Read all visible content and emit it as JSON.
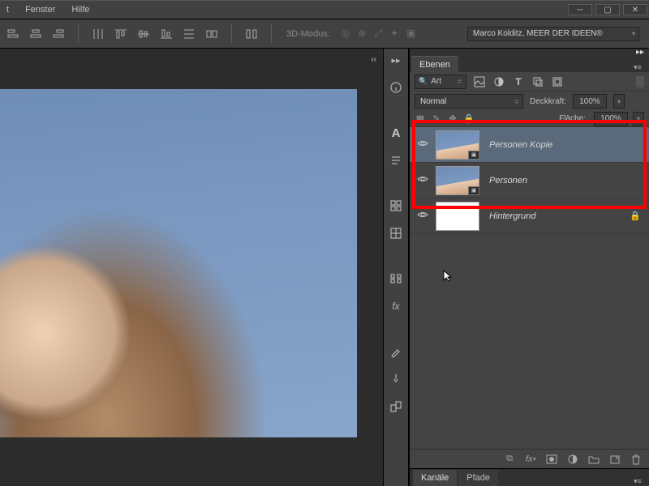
{
  "menu": {
    "items": [
      "t",
      "Fenster",
      "Hilfe"
    ]
  },
  "optbar": {
    "mode3d_label": "3D-Modus:",
    "userbox": "Marco Kolditz, MEER DER IDEEN®"
  },
  "layers_panel": {
    "tab": "Ebenen",
    "kind_filter": "Art",
    "blend_mode": "Normal",
    "opacity_label": "Deckkraft:",
    "opacity_value": "100%",
    "fill_label": "Fläche:",
    "fill_value": "100%",
    "layers": [
      {
        "name": "Personen Kopie",
        "visible": true,
        "selected": true,
        "smart": true,
        "locked": false
      },
      {
        "name": "Personen",
        "visible": true,
        "selected": false,
        "smart": true,
        "locked": false
      },
      {
        "name": "Hintergrund",
        "visible": true,
        "selected": false,
        "smart": false,
        "locked": true,
        "white": true
      }
    ]
  },
  "subtabs": {
    "channels": "Kanäle",
    "paths": "Pfade"
  },
  "icons": {
    "align": [
      "align-left",
      "align-hcenter",
      "align-right",
      "distribute-h",
      "align-top",
      "align-vcenter",
      "align-bottom",
      "distribute-v",
      "auto-align"
    ],
    "filter": [
      "image-filter",
      "adjust-filter",
      "type-filter",
      "shape-filter",
      "smart-filter"
    ],
    "rail": [
      "info",
      "character",
      "swatches",
      "dummy",
      "grid",
      "thumbnails",
      "styles",
      "thumbnails2",
      "brush1",
      "brush2",
      "clone"
    ],
    "bottom": [
      "link",
      "fx",
      "mask",
      "adjustment",
      "group",
      "new",
      "trash"
    ]
  }
}
